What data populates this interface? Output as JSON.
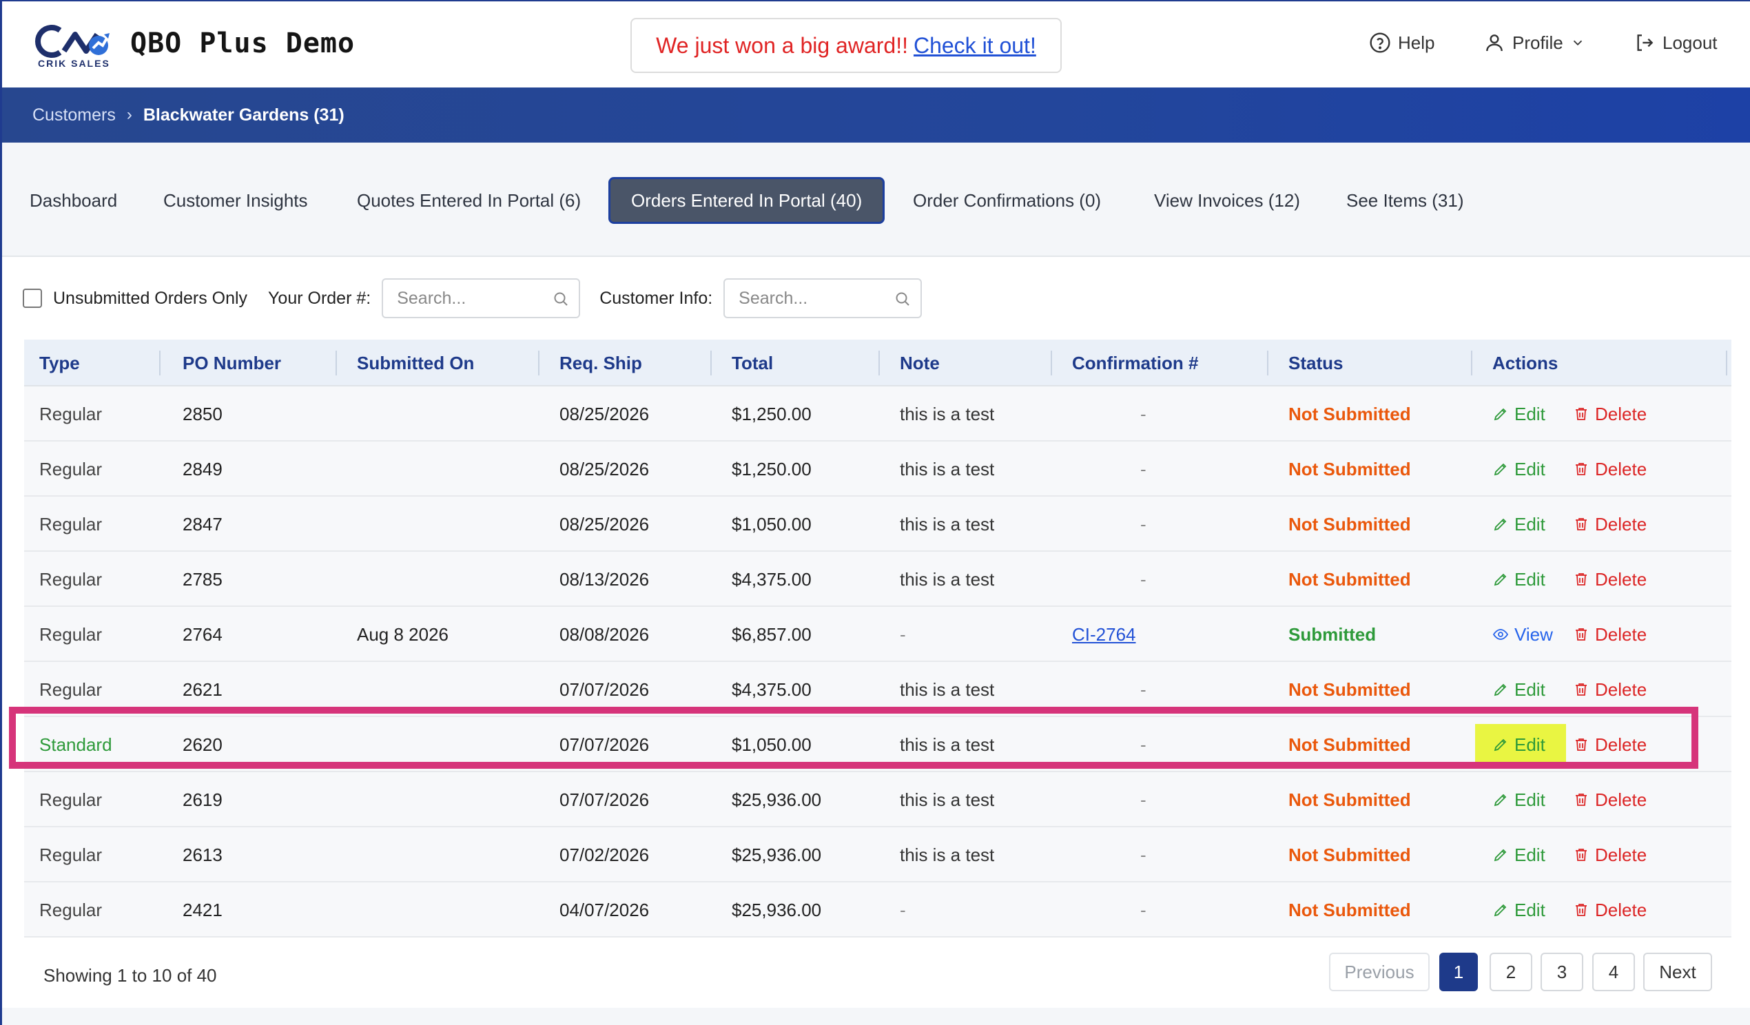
{
  "header": {
    "logo_text": "CRIK SALES",
    "app_title": "QBO Plus Demo",
    "award_text": "We just won a big award!!",
    "award_link": "Check it out!",
    "help": "Help",
    "profile": "Profile",
    "logout": "Logout"
  },
  "breadcrumb": {
    "parent": "Customers",
    "separator": "›",
    "current": "Blackwater Gardens (31)"
  },
  "tabs": [
    {
      "label": "Dashboard"
    },
    {
      "label": "Customer Insights"
    },
    {
      "label": "Quotes Entered In Portal (6)"
    },
    {
      "label": "Orders Entered In Portal (40)"
    },
    {
      "label": "Order Confirmations (0)"
    },
    {
      "label": "View Invoices (12)"
    },
    {
      "label": "See Items (31)"
    }
  ],
  "filters": {
    "unsubmitted_label": "Unsubmitted Orders Only",
    "order_label": "Your Order #:",
    "order_placeholder": "Search...",
    "customer_label": "Customer Info:",
    "customer_placeholder": "Search..."
  },
  "table": {
    "headers": [
      "Type",
      "PO Number",
      "Submitted On",
      "Req. Ship",
      "Total",
      "Note",
      "Confirmation #",
      "Status",
      "Actions"
    ],
    "rows": [
      {
        "type": "Regular",
        "po": "2850",
        "submitted": "",
        "ship": "08/25/2026",
        "total": "$1,250.00",
        "note": "this is a test",
        "conf": "-",
        "status": "Not Submitted",
        "act1": "Edit",
        "act2": "Delete"
      },
      {
        "type": "Regular",
        "po": "2849",
        "submitted": "",
        "ship": "08/25/2026",
        "total": "$1,250.00",
        "note": "this is a test",
        "conf": "-",
        "status": "Not Submitted",
        "act1": "Edit",
        "act2": "Delete"
      },
      {
        "type": "Regular",
        "po": "2847",
        "submitted": "",
        "ship": "08/25/2026",
        "total": "$1,050.00",
        "note": "this is a test",
        "conf": "-",
        "status": "Not Submitted",
        "act1": "Edit",
        "act2": "Delete"
      },
      {
        "type": "Regular",
        "po": "2785",
        "submitted": "",
        "ship": "08/13/2026",
        "total": "$4,375.00",
        "note": "this is a test",
        "conf": "-",
        "status": "Not Submitted",
        "act1": "Edit",
        "act2": "Delete"
      },
      {
        "type": "Regular",
        "po": "2764",
        "submitted": "Aug 8 2026",
        "ship": "08/08/2026",
        "total": "$6,857.00",
        "note": "-",
        "conf": "CI-2764",
        "status": "Submitted",
        "act1": "View",
        "act2": "Delete"
      },
      {
        "type": "Regular",
        "po": "2621",
        "submitted": "",
        "ship": "07/07/2026",
        "total": "$4,375.00",
        "note": "this is a test",
        "conf": "-",
        "status": "Not Submitted",
        "act1": "Edit",
        "act2": "Delete"
      },
      {
        "type": "Standard",
        "po": "2620",
        "submitted": "",
        "ship": "07/07/2026",
        "total": "$1,050.00",
        "note": "this is a test",
        "conf": "-",
        "status": "Not Submitted",
        "act1": "Edit",
        "act2": "Delete"
      },
      {
        "type": "Regular",
        "po": "2619",
        "submitted": "",
        "ship": "07/07/2026",
        "total": "$25,936.00",
        "note": "this is a test",
        "conf": "-",
        "status": "Not Submitted",
        "act1": "Edit",
        "act2": "Delete"
      },
      {
        "type": "Regular",
        "po": "2613",
        "submitted": "",
        "ship": "07/02/2026",
        "total": "$25,936.00",
        "note": "this is a test",
        "conf": "-",
        "status": "Not Submitted",
        "act1": "Edit",
        "act2": "Delete"
      },
      {
        "type": "Regular",
        "po": "2421",
        "submitted": "",
        "ship": "04/07/2026",
        "total": "$25,936.00",
        "note": "-",
        "conf": "-",
        "status": "Not Submitted",
        "act1": "Edit",
        "act2": "Delete"
      }
    ]
  },
  "pagination": {
    "showing": "Showing 1 to 10 of 40",
    "previous": "Previous",
    "pages": [
      "1",
      "2",
      "3",
      "4"
    ],
    "next": "Next"
  },
  "colors": {
    "brand_blue": "#1e3a8a",
    "status_not_submitted": "#ea580c",
    "status_submitted": "#2e9a3a",
    "delete_red": "#dc2626",
    "highlight_box": "#d6347a",
    "highlight_edit": "#e9f542"
  },
  "icons": {
    "help": "help-circle-icon",
    "profile": "user-icon",
    "logout": "logout-icon",
    "edit": "pencil-icon",
    "view": "eye-icon",
    "delete": "trash-icon",
    "search": "search-icon"
  }
}
